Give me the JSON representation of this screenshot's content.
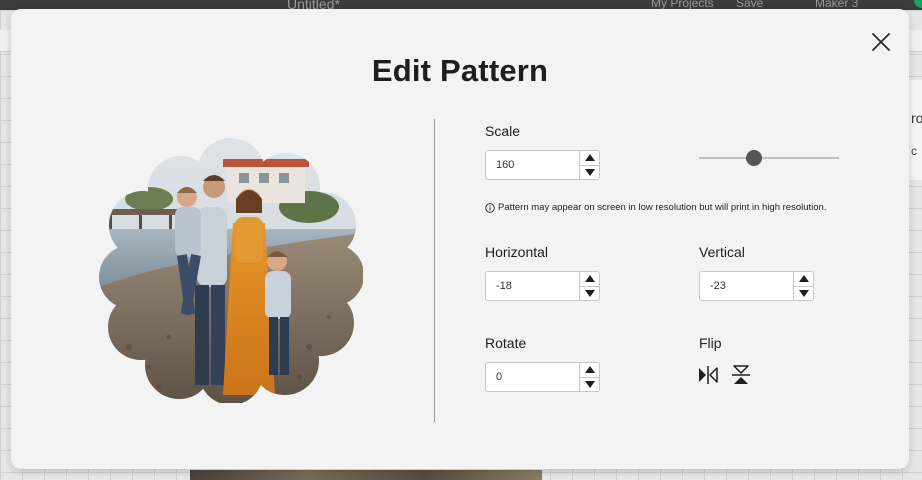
{
  "background": {
    "doc_title": "Untitled*",
    "nav_projects": "My Projects",
    "nav_save": "Save",
    "nav_machine": "Maker 3"
  },
  "modal": {
    "title": "Edit Pattern",
    "close_icon": "close-icon"
  },
  "scale": {
    "label": "Scale",
    "value": "160",
    "slider_level": 0.39
  },
  "note": {
    "icon": "info-icon",
    "text": "Pattern may appear on screen in low resolution but will print in high resolution."
  },
  "horizontal": {
    "label": "Horizontal",
    "value": "-18"
  },
  "vertical": {
    "label": "Vertical",
    "value": "-23"
  },
  "rotate": {
    "label": "Rotate",
    "value": "0"
  },
  "flip": {
    "label": "Flip",
    "horizontal_icon": "flip-horizontal-icon",
    "vertical_icon": "flip-vertical-icon"
  },
  "colors": {
    "modal_bg": "#f3f3f3",
    "title": "#1e1e1e",
    "knob": "#545454",
    "track": "#c0c0c0"
  }
}
